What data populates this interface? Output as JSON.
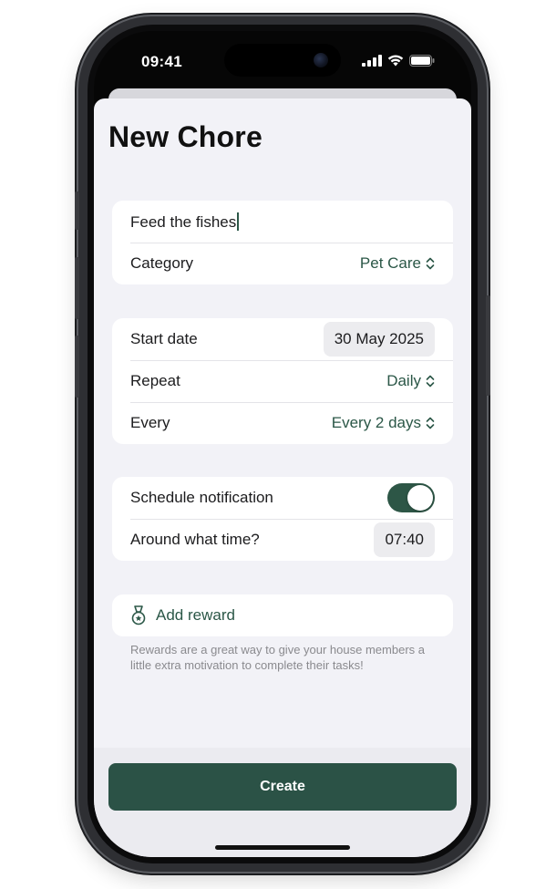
{
  "status_bar": {
    "time": "09:41"
  },
  "screen_title": "New Chore",
  "chore_card": {
    "name_value": "Feed the fishes",
    "category_label": "Category",
    "category_value": "Pet Care"
  },
  "schedule_card": {
    "start_date_label": "Start date",
    "start_date_value": "30 May 2025",
    "repeat_label": "Repeat",
    "repeat_value": "Daily",
    "every_label": "Every",
    "every_value": "Every 2 days"
  },
  "notification_card": {
    "schedule_label": "Schedule notification",
    "schedule_enabled": true,
    "time_label": "Around what time?",
    "time_value": "07:40"
  },
  "reward": {
    "label": "Add reward",
    "note": "Rewards are a great way to give your house members a little extra motivation to complete their tasks!"
  },
  "create_button": {
    "label": "Create"
  },
  "colors": {
    "accent": "#2b5747",
    "button": "#2b5246",
    "background": "#f2f2f7"
  },
  "icons": [
    "signal-icon",
    "wifi-icon",
    "battery-icon",
    "chevron-updown-icon",
    "medal-icon"
  ]
}
